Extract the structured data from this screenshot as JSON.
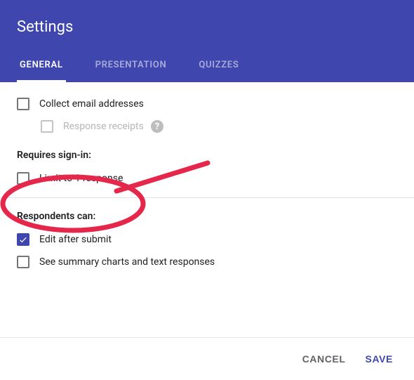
{
  "header": {
    "title": "Settings"
  },
  "tabs": [
    {
      "label": "GENERAL",
      "active": true
    },
    {
      "label": "PRESENTATION",
      "active": false
    },
    {
      "label": "QUIZZES",
      "active": false
    }
  ],
  "options": {
    "collect_email": "Collect email addresses",
    "response_receipts": "Response receipts"
  },
  "requires_signin": {
    "heading": "Requires sign-in:",
    "limit_one": "Limit to 1 response"
  },
  "respondents_can": {
    "heading": "Respondents can:",
    "edit_after_submit": "Edit after submit",
    "see_summary": "See summary charts and text responses"
  },
  "footer": {
    "cancel": "CANCEL",
    "save": "SAVE"
  }
}
